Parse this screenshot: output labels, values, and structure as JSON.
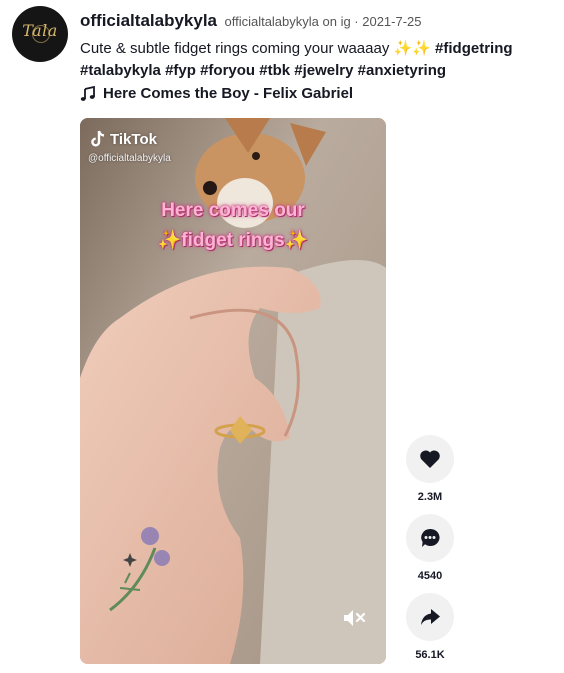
{
  "author": {
    "avatar_text": "Tala",
    "name": "officialtalabykyla",
    "meta": "officialtalabykyla on ig · 2021-7-25"
  },
  "caption": {
    "text": "Cute & subtle fidget rings coming your waaaay ✨✨",
    "hashtags_line1": [
      "#fidgetring"
    ],
    "hashtags_line2": [
      "#talabykyla",
      "#fyp",
      "#foryou",
      "#tbk",
      "#jewelry",
      "#anxietyring"
    ]
  },
  "music": {
    "icon": "music-note-icon",
    "title": "Here Comes the Boy - Felix Gabriel"
  },
  "video": {
    "watermark": "TikTok",
    "handle": "@officialtalabykyla",
    "overlay_line1": "Here comes our",
    "overlay_line2": "✨fidget rings✨",
    "mute_icon": "mute-icon"
  },
  "actions": {
    "like": {
      "icon": "heart-icon",
      "count": "2.3M"
    },
    "comment": {
      "icon": "comment-icon",
      "count": "4540"
    },
    "share": {
      "icon": "share-icon",
      "count": "56.1K"
    }
  }
}
